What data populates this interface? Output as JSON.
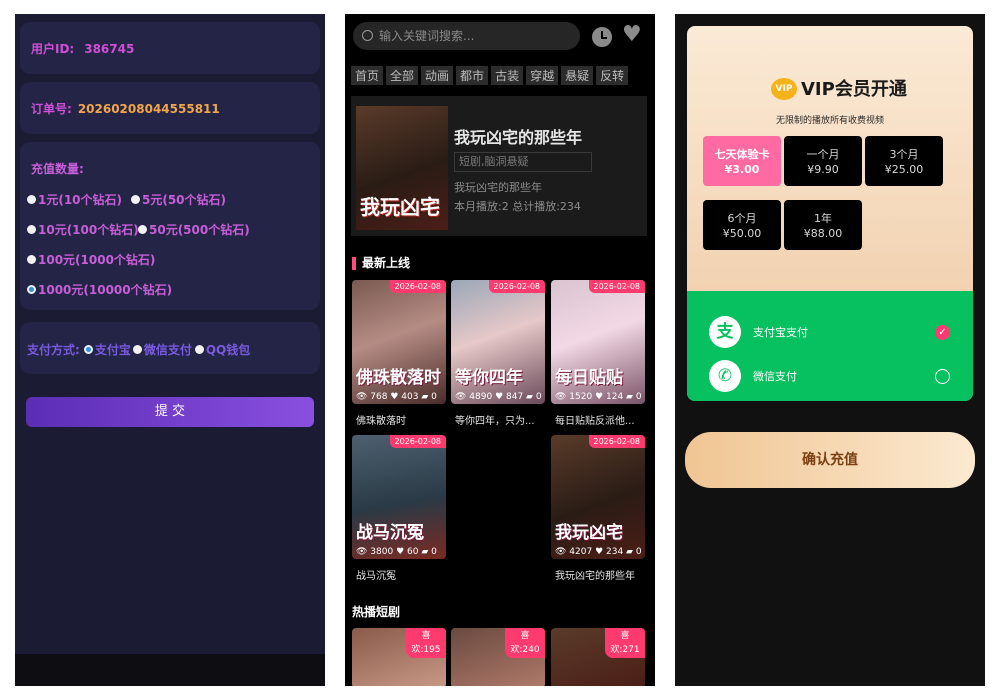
{
  "recharge": {
    "user_id_label": "用户ID:",
    "user_id_value": "386745",
    "order_label": "订单号:",
    "order_value": "20260208044555811",
    "quantity_label": "充值数量:",
    "options": [
      {
        "label": "1元(10个钻石)",
        "selected": false
      },
      {
        "label": "5元(50个钻石)",
        "selected": false
      },
      {
        "label": "10元(100个钻石)",
        "selected": false
      },
      {
        "label": "50元(500个钻石)",
        "selected": false
      },
      {
        "label": "100元(1000个钻石)",
        "selected": false
      },
      {
        "label": "1000元(10000个钻石)",
        "selected": true
      }
    ],
    "payment_label": "支付方式:",
    "payment_options": [
      {
        "label": "支付宝",
        "selected": true
      },
      {
        "label": "微信支付",
        "selected": false
      },
      {
        "label": "QQ钱包",
        "selected": false
      }
    ],
    "submit_label": "提 交"
  },
  "drama": {
    "search_placeholder": "输入关键词搜索...",
    "tabs": [
      "首页",
      "全部",
      "动画",
      "都市",
      "古装",
      "穿越",
      "悬疑",
      "反转"
    ],
    "featured": {
      "poster_text": "我玩凶宅",
      "title": "我玩凶宅的那些年",
      "tags": "短剧,脑洞悬疑",
      "subtitle": "我玩凶宅的那些年",
      "stats": "本月播放:2  总计播放:234"
    },
    "latest_title": "最新上线",
    "latest": [
      {
        "date": "2026-02-08",
        "poster_text": "佛珠散落时",
        "views": "768",
        "likes": "403",
        "comments": "0",
        "caption": "佛珠散落时"
      },
      {
        "date": "2026-02-08",
        "poster_text": "等你四年",
        "views": "4890",
        "likes": "847",
        "comments": "0",
        "caption": "等你四年，只为..."
      },
      {
        "date": "2026-02-08",
        "poster_text": "每日贴贴",
        "views": "1520",
        "likes": "124",
        "comments": "0",
        "caption": "每日贴贴反派他..."
      },
      {
        "date": "2026-02-08",
        "poster_text": "战马沉冤",
        "views": "3800",
        "likes": "60",
        "comments": "0",
        "caption": "战马沉冤"
      },
      {
        "date": "2026-02-08",
        "poster_text": "我玩凶宅",
        "views": "4207",
        "likes": "234",
        "comments": "0",
        "caption": "我玩凶宅的那些年"
      }
    ],
    "hot_title": "热播短剧",
    "hot": [
      {
        "badge_line1": "喜",
        "badge_line2": "欢:195"
      },
      {
        "badge_line1": "喜",
        "badge_line2": "欢:240"
      },
      {
        "badge_line1": "喜",
        "badge_line2": "欢:271"
      }
    ],
    "icons": {
      "search": "search-icon",
      "history": "clock-icon",
      "favorite": "heart-icon"
    }
  },
  "vip": {
    "badge": "VIP",
    "title": "VIP会员开通",
    "subtitle": "无限制的播放所有收费视频",
    "plans": [
      {
        "name": "七天体验卡",
        "price": "¥3.00",
        "selected": true
      },
      {
        "name": "一个月",
        "price": "¥9.90",
        "selected": false
      },
      {
        "name": "3个月",
        "price": "¥25.00",
        "selected": false
      },
      {
        "name": "6个月",
        "price": "¥50.00",
        "selected": false
      },
      {
        "name": "1年",
        "price": "¥88.00",
        "selected": false
      }
    ],
    "payments": [
      {
        "name": "支付宝支付",
        "icon": "alipay-icon",
        "glyph": "支",
        "selected": true
      },
      {
        "name": "微信支付",
        "icon": "wechat-icon",
        "glyph": "✆",
        "selected": false
      }
    ],
    "confirm_label": "确认充值",
    "colors": {
      "pay_green": "#07c160",
      "accent_pink": "#ff3a6e",
      "card_gold": "#eec8a2"
    }
  }
}
